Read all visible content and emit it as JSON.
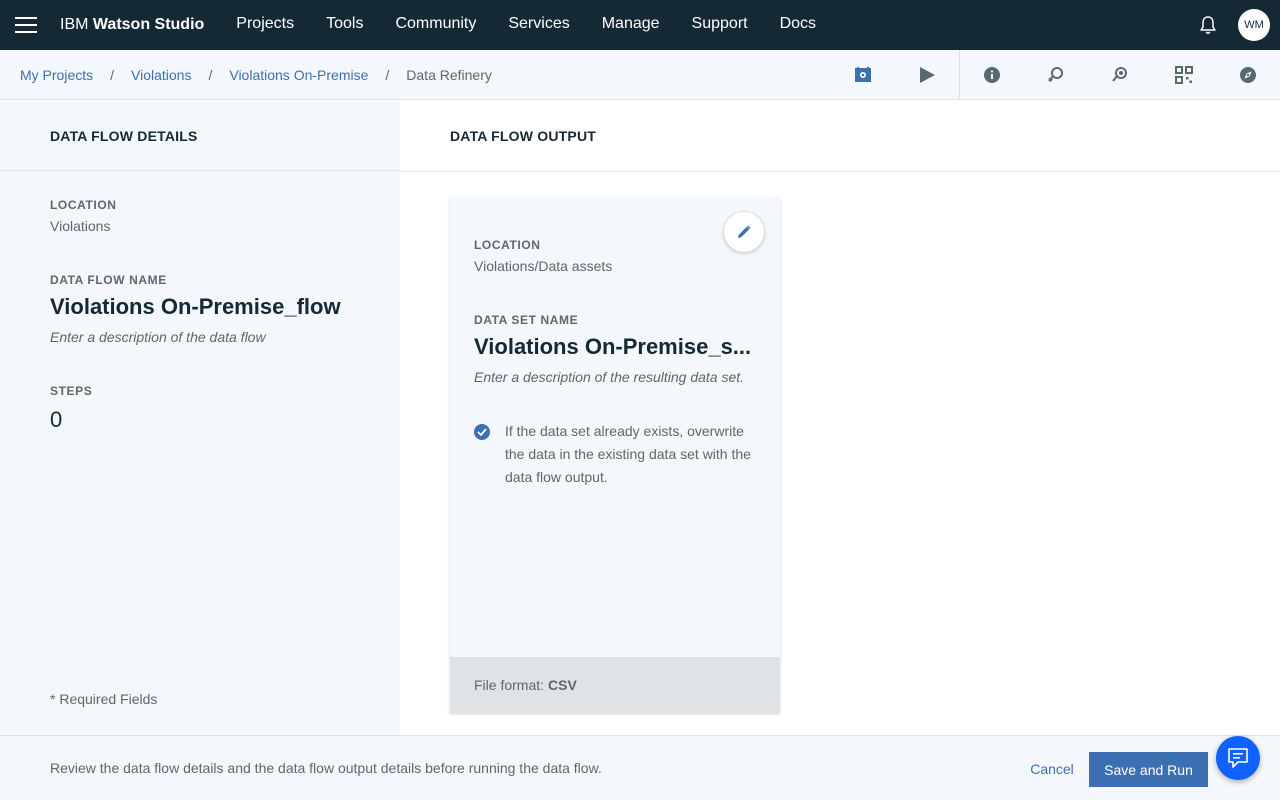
{
  "topbar": {
    "brand_prefix": "IBM",
    "brand_name": "Watson Studio",
    "nav": [
      "Projects",
      "Tools",
      "Community",
      "Services",
      "Manage",
      "Support",
      "Docs"
    ],
    "avatar_initials": "WM"
  },
  "breadcrumb": {
    "items": [
      "My Projects",
      "Violations",
      "Violations On-Premise"
    ],
    "separator": "/",
    "current": "Data Refinery"
  },
  "left": {
    "header": "DATA FLOW DETAILS",
    "location_label": "LOCATION",
    "location_value": "Violations",
    "name_label": "DATA FLOW NAME",
    "name_value": "Violations On-Premise_flow",
    "description_placeholder": "Enter a description of the data flow",
    "steps_label": "STEPS",
    "steps_value": "0",
    "required_note": "* Required Fields"
  },
  "right": {
    "header": "DATA FLOW OUTPUT",
    "card": {
      "location_label": "LOCATION",
      "location_value": "Violations/Data assets",
      "dataset_label": "DATA SET NAME",
      "dataset_value": "Violations On-Premise_s...",
      "description_placeholder": "Enter a description of the resulting data set.",
      "overwrite_text": "If the data set already exists, overwrite the data in the existing data set with the data flow output.",
      "overwrite_checked": true,
      "file_format_label": "File format:",
      "file_format_value": "CSV"
    }
  },
  "bottom": {
    "message": "Review the data flow details and the data flow output details before running the data flow.",
    "cancel_label": "Cancel",
    "save_label": "Save and Run"
  },
  "colors": {
    "topbar": "#152935",
    "accent": "#3d70b2",
    "panel": "#f4f7fb",
    "chat": "#0f62fe"
  },
  "icons": [
    "menu-icon",
    "notification-bell-icon",
    "schedule-icon",
    "run-icon",
    "info-icon",
    "undo-history-icon",
    "redo-history-icon",
    "qr-grid-icon",
    "compass-icon",
    "pencil-icon",
    "checkmark-icon",
    "chat-icon"
  ]
}
